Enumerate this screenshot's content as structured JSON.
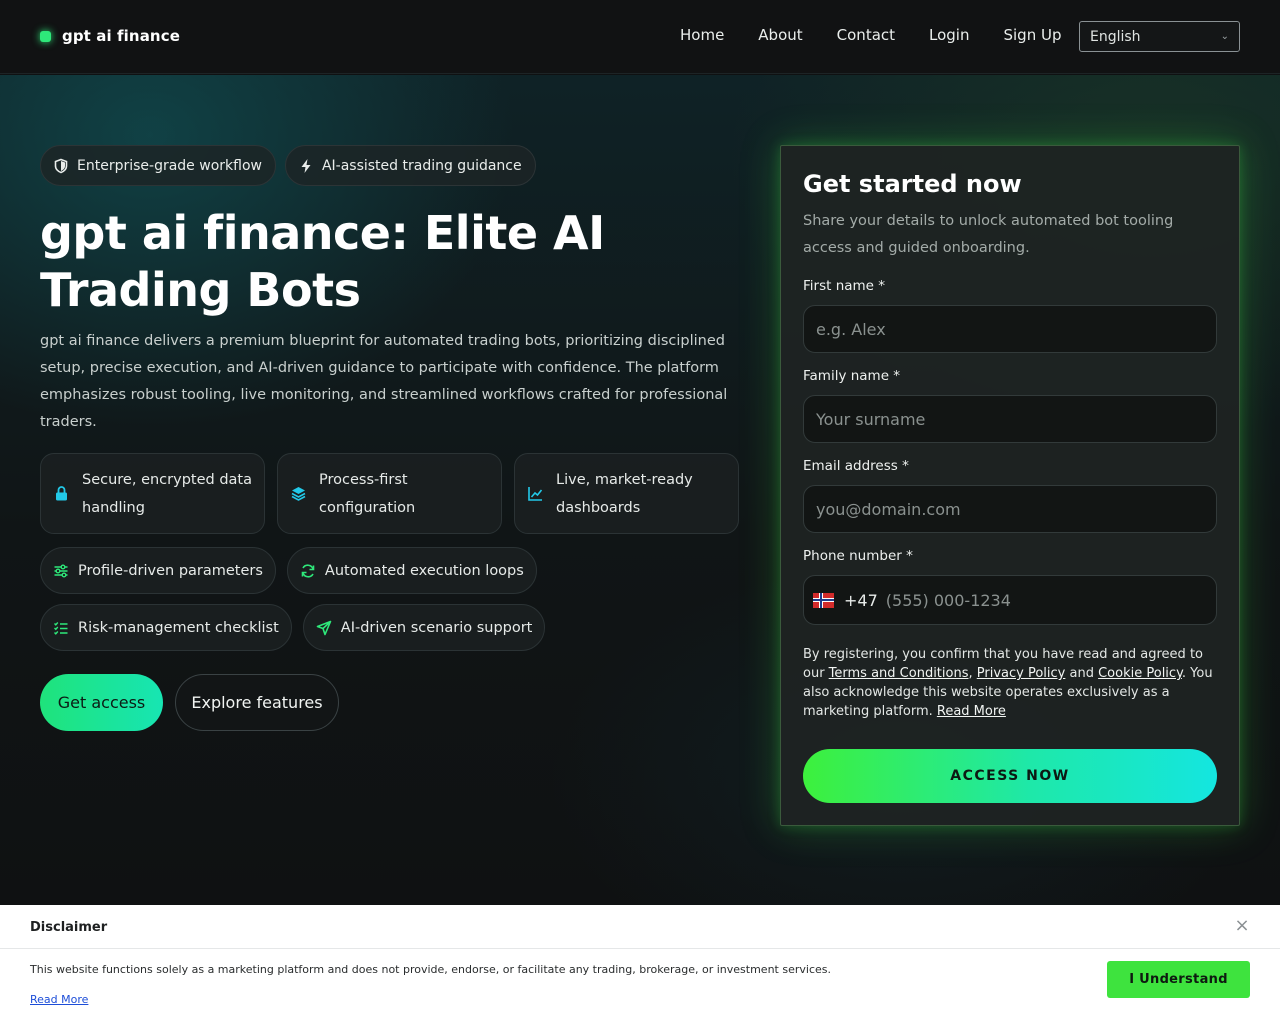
{
  "brand": {
    "name": "gpt ai finance",
    "accent": "#2ee87a"
  },
  "nav": {
    "links": [
      "Home",
      "About",
      "Contact",
      "Login",
      "Sign Up"
    ],
    "language": {
      "selected": "English"
    }
  },
  "hero": {
    "tags": [
      {
        "label": "Enterprise-grade workflow",
        "icon": "shield-icon"
      },
      {
        "label": "AI-assisted trading guidance",
        "icon": "bolt-icon"
      }
    ],
    "title": "gpt ai finance: Elite AI Trading Bots",
    "description": "gpt ai finance delivers a premium blueprint for automated trading bots, prioritizing disciplined setup, precise execution, and AI-driven guidance to participate with confidence. The platform emphasizes robust tooling, live monitoring, and streamlined workflows crafted for professional traders.",
    "features": [
      {
        "label": "Secure, encrypted data handling",
        "icon": "lock-icon"
      },
      {
        "label": "Process-first configuration",
        "icon": "layers-icon"
      },
      {
        "label": "Live, market-ready dashboards",
        "icon": "chart-icon"
      }
    ],
    "chips_row1": [
      {
        "label": "Profile-driven parameters",
        "icon": "sliders-icon"
      },
      {
        "label": "Automated execution loops",
        "icon": "refresh-icon"
      }
    ],
    "chips_row2": [
      {
        "label": "Risk-management checklist",
        "icon": "checklist-icon"
      },
      {
        "label": "AI-driven scenario support",
        "icon": "send-icon"
      }
    ],
    "cta_primary": "Get access",
    "cta_secondary": "Explore features"
  },
  "form": {
    "title": "Get started now",
    "subtitle": "Share your details to unlock automated bot tooling access and guided onboarding.",
    "first_name": {
      "label": "First name *",
      "placeholder": "e.g. Alex"
    },
    "family_name": {
      "label": "Family name *",
      "placeholder": "Your surname"
    },
    "email": {
      "label": "Email address *",
      "placeholder": "you@domain.com"
    },
    "phone": {
      "label": "Phone number *",
      "dial_code": "+47",
      "placeholder": "(555) 000-1234",
      "flag": "norway-flag-icon"
    },
    "consent": {
      "prefix": "By registering, you confirm that you have read and agreed to our ",
      "terms": "Terms and Conditions",
      "sep1": ", ",
      "privacy": "Privacy Policy",
      "and": " and ",
      "cookie": "Cookie Policy",
      "suffix": ". You also acknowledge this website operates exclusively as a marketing platform. ",
      "read_more": "Read More"
    },
    "submit": "ACCESS NOW"
  },
  "disclaimer": {
    "title": "Disclaimer",
    "text": "This website functions solely as a marketing platform and does not provide, endorse, or facilitate any trading, brokerage, or investment services.",
    "read_more": "Read More",
    "button": "I Understand",
    "close": "×"
  }
}
